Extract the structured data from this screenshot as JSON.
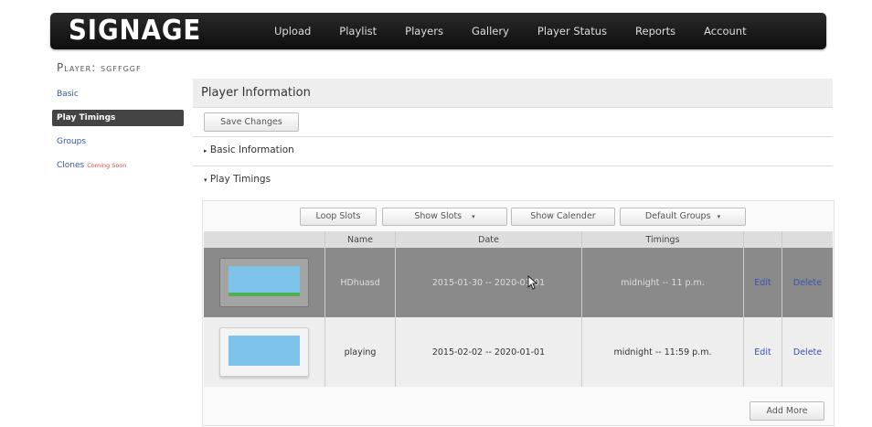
{
  "app": {
    "logo": "SIGNAGE"
  },
  "nav": [
    "Upload",
    "Playlist",
    "Players",
    "Gallery",
    "Player Status",
    "Reports",
    "Account"
  ],
  "player_title": "Player: sgffggf",
  "sidebar": {
    "items": [
      {
        "label": "Basic"
      },
      {
        "label": "Play Timings",
        "active": true
      },
      {
        "label": "Groups"
      },
      {
        "label": "Clones",
        "badge": "Coming Soon"
      }
    ]
  },
  "main": {
    "header": "Player Information",
    "save_label": "Save Changes",
    "section_basic": "Basic Information",
    "section_play": "Play Timings",
    "toolbar": {
      "loop_slots": "Loop Slots",
      "show_slots": "Show Slots",
      "show_calender": "Show Calender",
      "default_groups": "Default Groups"
    },
    "table": {
      "columns": [
        "",
        "Name",
        "Date",
        "Timings",
        "",
        ""
      ],
      "rows": [
        {
          "name": "HDhuasd",
          "date": "2015-01-30 -- 2020-01-01",
          "timings": "midnight -- 11 p.m.",
          "edit": "Edit",
          "delete": "Delete"
        },
        {
          "name": "playing",
          "date": "2015-02-02 -- 2020-01-01",
          "timings": "midnight -- 11:59 p.m.",
          "edit": "Edit",
          "delete": "Delete"
        }
      ]
    },
    "add_more": "Add More"
  },
  "icons": {
    "caret": "triangle-right-icon",
    "dropdown": "caret-down-icon"
  }
}
